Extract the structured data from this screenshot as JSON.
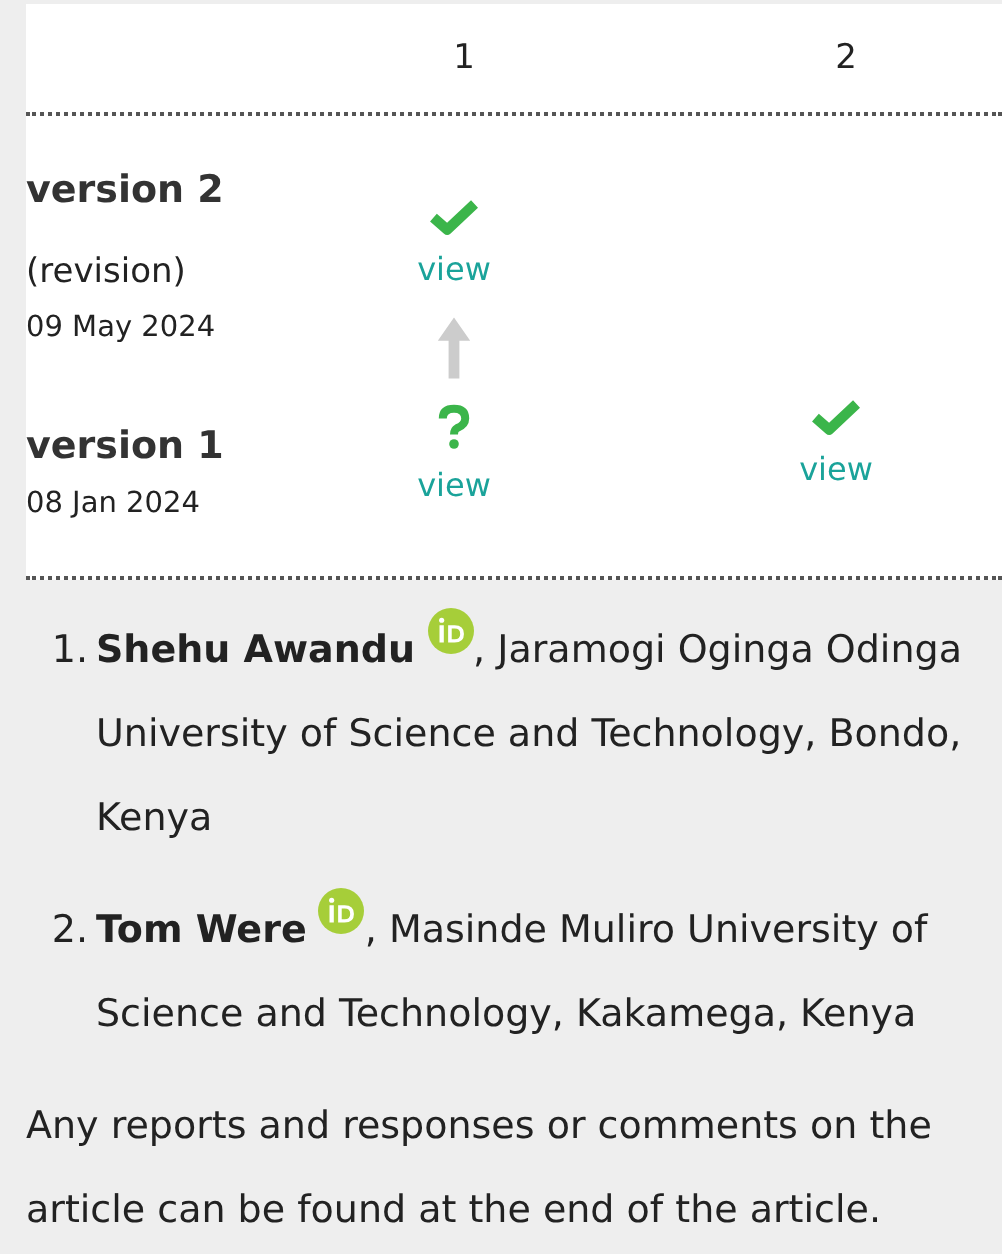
{
  "reviewers": [
    "1",
    "2"
  ],
  "versions": [
    {
      "title": "version 2",
      "note": "(revision)",
      "date": "09 May 2024",
      "revised_from_previous": true,
      "reports": [
        {
          "kind": "approved",
          "link": "view"
        }
      ]
    },
    {
      "title": "version 1",
      "date": "08 Jan 2024",
      "reports": [
        {
          "kind": "reservations",
          "link": "view"
        },
        {
          "kind": "approved",
          "link": "view"
        }
      ]
    }
  ],
  "authors": [
    {
      "number": "1.",
      "name": "Shehu Awandu",
      "orcid": true,
      "affiliation": ", Jaramogi Oginga Odinga University of Science and Technology, Bondo, Kenya"
    },
    {
      "number": "2.",
      "name": "Tom Were",
      "orcid": true,
      "affiliation": ", Masinde Muliro University of Science and Technology, Kakamega, Kenya"
    }
  ],
  "footer": "Any reports and responses or comments on the article can be found at the end of the article."
}
